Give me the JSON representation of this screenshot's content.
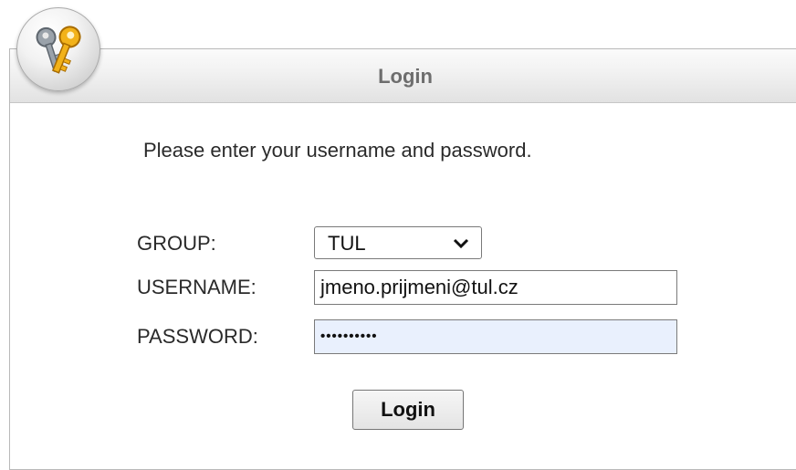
{
  "header": {
    "title": "Login",
    "icon": "keys-icon"
  },
  "form": {
    "instructions": "Please enter your username and password.",
    "group": {
      "label": "GROUP:",
      "value": "TUL"
    },
    "username": {
      "label": "USERNAME:",
      "value": "jmeno.prijmeni@tul.cz"
    },
    "password": {
      "label": "PASSWORD:",
      "value": "••••••••••"
    },
    "submit_label": "Login"
  },
  "colors": {
    "header_text": "#6d6d6d",
    "autofill_bg": "#e9f0fd"
  }
}
